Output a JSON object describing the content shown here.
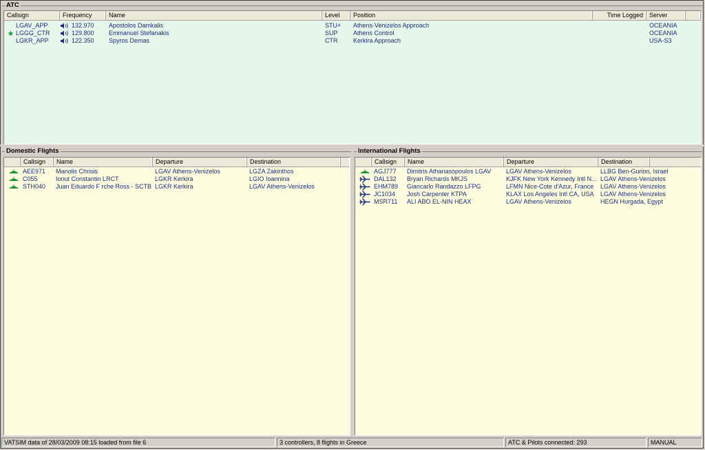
{
  "atc": {
    "title": "ATC",
    "columns": [
      "Callsign",
      "Frequency",
      "Name",
      "Level",
      "Position",
      "Time Logged",
      "Server"
    ],
    "rows": [
      {
        "star": false,
        "callsign": "LGAV_APP",
        "frequency": "132.970",
        "name": "Apostolos Damkalis",
        "level": "STU+",
        "position": "Athens-Venizelos Approach",
        "time": "",
        "server": "OCEANIA"
      },
      {
        "star": true,
        "callsign": "LGGG_CTR",
        "frequency": "129.800",
        "name": "Emmanuel Stefanakis",
        "level": "SUP",
        "position": "Athens Control",
        "time": "",
        "server": "OCEANIA"
      },
      {
        "star": false,
        "callsign": "LGKR_APP",
        "frequency": "122.350",
        "name": "Spyros Demas",
        "level": "CTR",
        "position": "Kerkira Approach",
        "time": "",
        "server": "USA-S3"
      }
    ]
  },
  "domestic": {
    "title": "Domestic Flights",
    "columns": [
      "Callsign",
      "Name",
      "Departure",
      "Destination"
    ],
    "rows": [
      {
        "icon": "departing-icon",
        "callsign": "AEE971",
        "name": "Manolis Chrisis",
        "departure": "LGAV Athens-Venizelos",
        "destination": "LGZA Zakinthos"
      },
      {
        "icon": "departing-icon",
        "callsign": "C055",
        "name": "Ionut Constantin LRCT",
        "departure": "LGKR Kerkira",
        "destination": "LGIO Ioannina"
      },
      {
        "icon": "departing-icon",
        "callsign": "STH040",
        "name": "Juan Eduardo F rche Ross  - SCTB",
        "departure": "LGKR Kerkira",
        "destination": "LGAV Athens-Venizelos"
      }
    ]
  },
  "international": {
    "title": "International Flights",
    "columns": [
      "Callsign",
      "Name",
      "Departure",
      "Destination"
    ],
    "rows": [
      {
        "icon": "departing-icon",
        "callsign": "AGJ777",
        "name": "Dimitris Athanasopoulos LGAV",
        "departure": "LGAV Athens-Venizelos",
        "destination": "LLBG Ben-Gurion, Israel"
      },
      {
        "icon": "airplane-icon",
        "callsign": "DAL132",
        "name": "Bryan Richards MKJS",
        "departure": "KJFK New York Kennedy Intl N...",
        "destination": "LGAV Athens-Venizelos"
      },
      {
        "icon": "airplane-icon",
        "callsign": "EHM789",
        "name": "Giancarlo Randazzo LFPG",
        "departure": "LFMN Nice-Cote d'Azur, France",
        "destination": "LGAV Athens-Venizelos"
      },
      {
        "icon": "airplane-icon",
        "callsign": "JC1034",
        "name": "Josh Carpenter KTPA",
        "departure": "KLAX Los Angeles Intl CA, USA",
        "destination": "LGAV Athens-Venizelos"
      },
      {
        "icon": "airplane-icon",
        "callsign": "MSR711",
        "name": "ALI ABO EL-NIN HEAX",
        "departure": "LGAV Athens-Venizelos",
        "destination": "HEGN Hurgada, Egypt"
      }
    ]
  },
  "statusbar": {
    "data_info": "VATSIM data of 28/03/2009 08:15 loaded from file 6",
    "summary": "3 controllers, 8 flights in Greece",
    "connected": "ATC & Pilots connected: 293",
    "mode": "MANUAL"
  },
  "colors": {
    "atc_bg": "#e6f6ea",
    "flights_bg": "#fefde0",
    "text": "#1a2f80",
    "departing_icon": "#1f9a3a",
    "airplane_icon": "#1a2f80",
    "star": "#1f9a3a"
  }
}
